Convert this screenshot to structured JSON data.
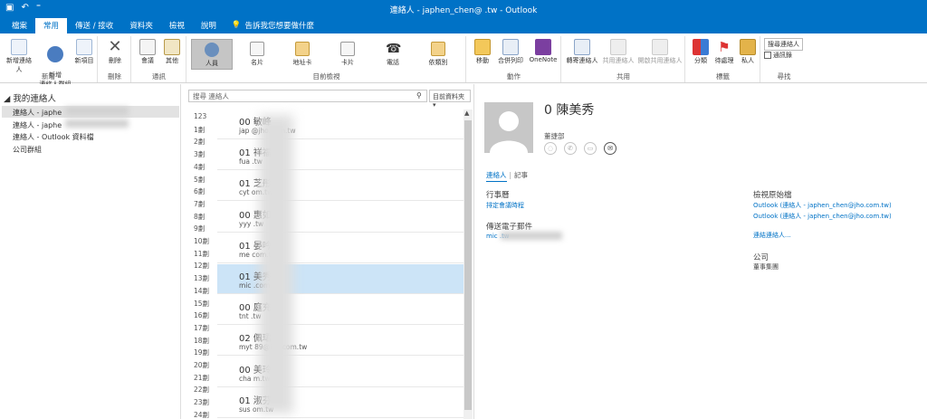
{
  "titlebar": {
    "title": "連絡人 - japhen_chen@           .tw  -  Outlook"
  },
  "tabs": [
    "檔案",
    "常用",
    "傳送 / 接收",
    "資料夾",
    "檢視",
    "說明"
  ],
  "tell_me": "告訴我您想要做什麼",
  "ribbon": {
    "new_contact": "新增連絡人",
    "new_group": "新增\n連絡人群組",
    "new_items": "新項目",
    "delete": "刪除",
    "meeting": "會議",
    "more": "其他",
    "views": [
      "人員",
      "名片",
      "地址卡",
      "卡片",
      "電話",
      "依類別"
    ],
    "move": "移動",
    "mail_merge": "合併列印",
    "onenote": "OneNote",
    "forward_contact": "轉寄連絡人",
    "share_contacts": "共用連絡人",
    "open_shared": "開啟共用連絡人",
    "categorize": "分類",
    "follow_up": "待處理",
    "private": "私人",
    "search_people": "搜尋連絡人",
    "address_book": "通訊錄",
    "groups": [
      "新增",
      "刪除",
      "通訊",
      "目前檢視",
      "動作",
      "共用",
      "標籤",
      "尋找"
    ]
  },
  "folders": {
    "header": "◢ 我的連絡人",
    "items": [
      "連絡人 - japhe",
      "連絡人 - japhe",
      "連絡人 - Outlook 資料檔",
      "公司群組"
    ]
  },
  "list": {
    "search_placeholder": "搜尋 連絡人",
    "scope": "目前資料夾",
    "index": [
      "123",
      "1劃",
      "2劃",
      "3劃",
      "4劃",
      "5劃",
      "6劃",
      "7劃",
      "8劃",
      "9劃",
      "10劃",
      "11劃",
      "12劃",
      "13劃",
      "14劃",
      "15劃",
      "16劃",
      "17劃",
      "18劃",
      "19劃",
      "20劃",
      "21劃",
      "22劃",
      "23劃",
      "24劃"
    ],
    "rows": [
      {
        "name": "00     敏峰",
        "email": "jap         @jho.com.tw"
      },
      {
        "name": "01     祥福",
        "email": "fua         .tw"
      },
      {
        "name": "01     芝彤",
        "email": "cyt         om.tw"
      },
      {
        "name": "00     惠如",
        "email": "yyy         .tw"
      },
      {
        "name": "01     晏吟",
        "email": "me          com.tw"
      },
      {
        "name": "01     美秀",
        "email": "mic         .com.tw"
      },
      {
        "name": "00     庭充",
        "email": "tnt         .tw"
      },
      {
        "name": "02     佩珺",
        "email": "myt         89@jho.com.tw"
      },
      {
        "name": "00     美玲",
        "email": "cha         m.tw"
      },
      {
        "name": "01     淑芬",
        "email": "sus         om.tw"
      }
    ]
  },
  "reading": {
    "name": "0      陳美秀",
    "org": "董捷部",
    "tab_contact": "連絡人",
    "tab_notes": "記事",
    "schedule_title": "行事曆",
    "schedule_link": "排定會議時程",
    "email_title": "傳送電子郵件",
    "email_value": "mic             .tw",
    "source_title": "檢視原始檔",
    "source_links": [
      "Outlook (連絡人 - japhen_chen@jho.com.tw)",
      "Outlook (連絡人 - japhen_chen@jho.com.tw)"
    ],
    "link_contacts": "連結連絡人...",
    "company_title": "公司",
    "company_value": "董事集團"
  },
  "colors": {
    "accent": "#0072c6",
    "selected_row": "#cce4f7"
  }
}
